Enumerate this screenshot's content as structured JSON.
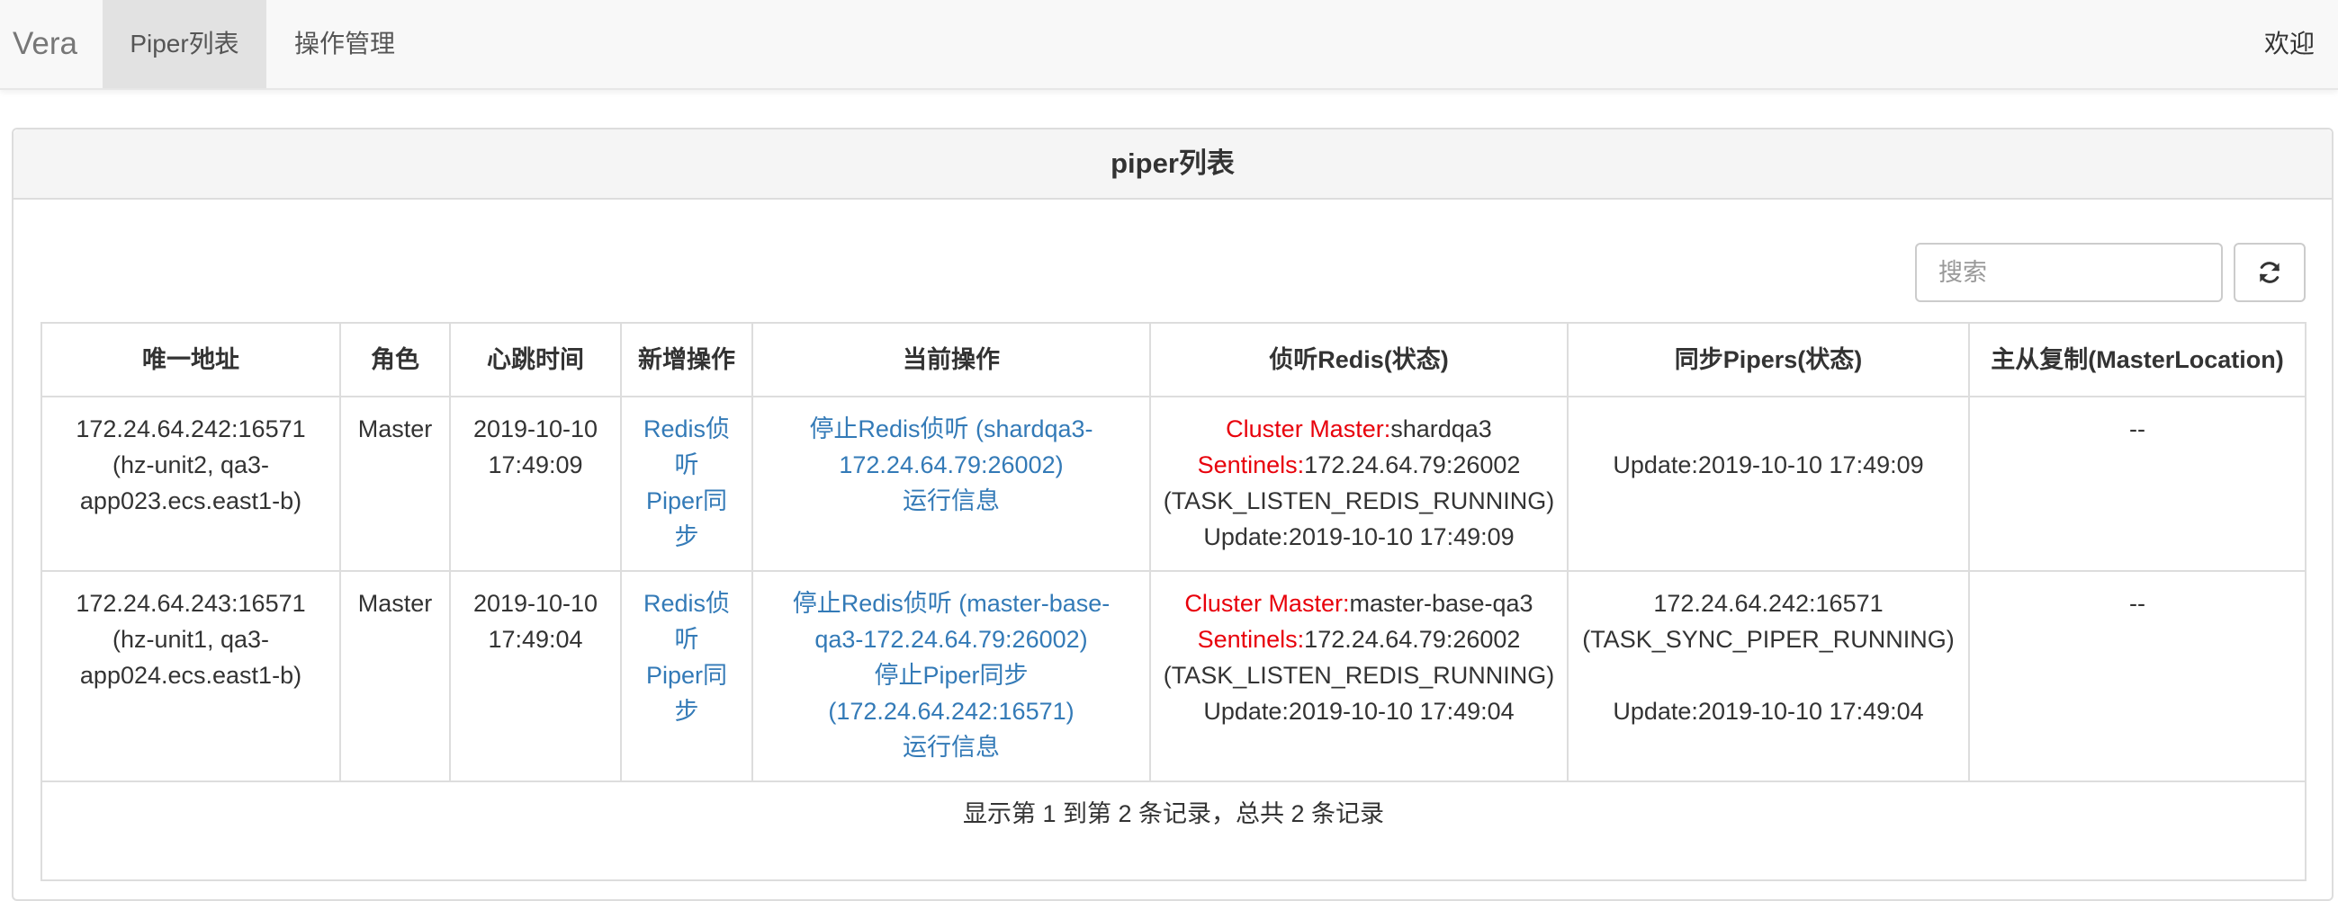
{
  "navbar": {
    "brand": "Vera",
    "tabs": [
      {
        "label": "Piper列表",
        "active": true
      },
      {
        "label": "操作管理",
        "active": false
      }
    ],
    "welcome": "欢迎"
  },
  "panel": {
    "title": "piper列表"
  },
  "toolbar": {
    "search_placeholder": "搜索",
    "refresh_icon": "refresh-icon"
  },
  "table": {
    "headers": [
      "唯一地址",
      "角色",
      "心跳时间",
      "新增操作",
      "当前操作",
      "侦听Redis(状态)",
      "同步Pipers(状态)",
      "主从复制(MasterLocation)"
    ],
    "rows": [
      {
        "address_1": "172.24.64.242:16571",
        "address_2": "(hz-unit2, qa3-",
        "address_3": "app023.ecs.east1-b)",
        "role": "Master",
        "heartbeat_1": "2019-10-10",
        "heartbeat_2": "17:49:09",
        "add_redis_1": "Redis侦",
        "add_redis_2": "听",
        "add_piper_1": "Piper同",
        "add_piper_2": "步",
        "op_stop_redis_1": "停止Redis侦听 (shardqa3-",
        "op_stop_redis_2": "172.24.64.79:26002)",
        "op_run_info": "运行信息",
        "redis_cluster_label": "Cluster Master:",
        "redis_cluster_value": "shardqa3",
        "redis_sentinels_label": "Sentinels:",
        "redis_sentinels_value": "172.24.64.79:26002",
        "redis_status": "(TASK_LISTEN_REDIS_RUNNING)",
        "redis_update": "Update:2019-10-10 17:49:09",
        "sync_update": "Update:2019-10-10 17:49:09",
        "master_location": "--"
      },
      {
        "address_1": "172.24.64.243:16571",
        "address_2": "(hz-unit1, qa3-",
        "address_3": "app024.ecs.east1-b)",
        "role": "Master",
        "heartbeat_1": "2019-10-10",
        "heartbeat_2": "17:49:04",
        "add_redis_1": "Redis侦",
        "add_redis_2": "听",
        "add_piper_1": "Piper同",
        "add_piper_2": "步",
        "op_stop_redis_1": "停止Redis侦听 (master-base-",
        "op_stop_redis_2": "qa3-172.24.64.79:26002)",
        "op_stop_piper_1": "停止Piper同步",
        "op_stop_piper_2": "(172.24.64.242:16571)",
        "op_run_info": "运行信息",
        "redis_cluster_label": "Cluster Master:",
        "redis_cluster_value": "master-base-qa3",
        "redis_sentinels_label": "Sentinels:",
        "redis_sentinels_value": "172.24.64.79:26002",
        "redis_status": "(TASK_LISTEN_REDIS_RUNNING)",
        "redis_update": "Update:2019-10-10 17:49:04",
        "sync_peer": "172.24.64.242:16571",
        "sync_status": "(TASK_SYNC_PIPER_RUNNING)",
        "sync_update": "Update:2019-10-10 17:49:04",
        "master_location": "--"
      }
    ],
    "footer": "显示第 1 到第 2 条记录，总共 2 条记录"
  },
  "colors": {
    "link": "#337ab7",
    "label_red": "#e8000b",
    "navbar_bg": "#f8f8f8",
    "active_tab_bg": "#e2e2e2",
    "panel_heading_bg": "#f5f5f5",
    "border": "#dddddd"
  }
}
